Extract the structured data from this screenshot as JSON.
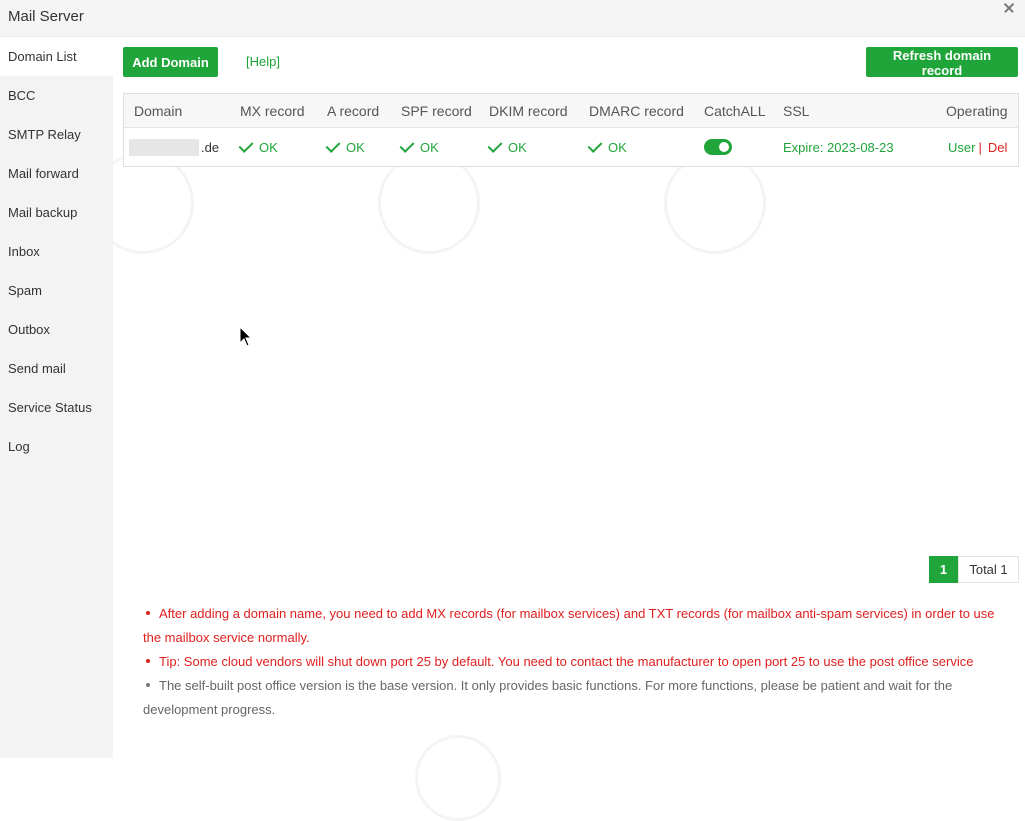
{
  "window": {
    "title": "Mail Server"
  },
  "sidebar": {
    "items": [
      {
        "label": "Domain List",
        "active": true
      },
      {
        "label": "BCC"
      },
      {
        "label": "SMTP Relay"
      },
      {
        "label": "Mail forward"
      },
      {
        "label": "Mail backup"
      },
      {
        "label": "Inbox"
      },
      {
        "label": "Spam"
      },
      {
        "label": "Outbox"
      },
      {
        "label": "Send mail"
      },
      {
        "label": "Service Status"
      },
      {
        "label": "Log"
      }
    ]
  },
  "toolbar": {
    "add_domain": "Add Domain",
    "help": "[Help]",
    "refresh": "Refresh domain record"
  },
  "table": {
    "headers": [
      "Domain",
      "MX record",
      "A record",
      "SPF record",
      "DKIM record",
      "DMARC record",
      "CatchALL",
      "SSL",
      "Operating"
    ],
    "rows": [
      {
        "domain_suffix": ".de",
        "mx": "OK",
        "a": "OK",
        "spf": "OK",
        "dkim": "OK",
        "dmarc": "OK",
        "catchall": true,
        "ssl": "Expire: 2023-08-23",
        "op_user": "User",
        "op_sep": "|",
        "op_del": "Del"
      }
    ]
  },
  "pagination": {
    "current": "1",
    "total": "Total 1"
  },
  "tips": [
    {
      "text": "After adding a domain name, you need to add MX records (for mailbox services) and TXT records (for mailbox anti-spam services) in order to use the mailbox service normally.",
      "color": "#e02020"
    },
    {
      "text": "Tip: Some cloud vendors will shut down port 25 by default. You need to contact the manufacturer to open port 25 to use the post office service",
      "color": "#e02020"
    },
    {
      "text": "The self-built post office version is the base version. It only provides basic functions. For more functions, please be patient and wait for the development progress.",
      "color": "#666666"
    }
  ],
  "colors": {
    "accent": "#20a53a",
    "danger": "#e02020"
  }
}
